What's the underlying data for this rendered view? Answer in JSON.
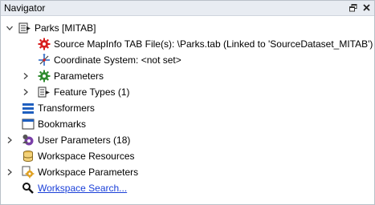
{
  "panel": {
    "title": "Navigator",
    "buttons": {
      "float_icon": "float-window-icon",
      "close_icon": "close-icon"
    }
  },
  "tree": {
    "dataset": {
      "label": "Parks [MITAB]",
      "expanded": true,
      "children": {
        "source": "Source MapInfo TAB File(s): \\Parks.tab (Linked to 'SourceDataset_MITAB')",
        "coord": "Coordinate System: <not set>",
        "parameters": "Parameters",
        "feature_types": "Feature Types (1)"
      }
    },
    "transformers": "Transformers",
    "bookmarks": "Bookmarks",
    "user_parameters": "User Parameters (18)",
    "workspace_resources": "Workspace Resources",
    "workspace_parameters": "Workspace Parameters",
    "workspace_search": "Workspace Search..."
  },
  "colors": {
    "titlebar_bg": "#e8ecf2",
    "link": "#1a3fd8",
    "accent_red": "#d81e1e",
    "accent_green": "#2e8b2e",
    "accent_blue": "#1f5fbf"
  }
}
